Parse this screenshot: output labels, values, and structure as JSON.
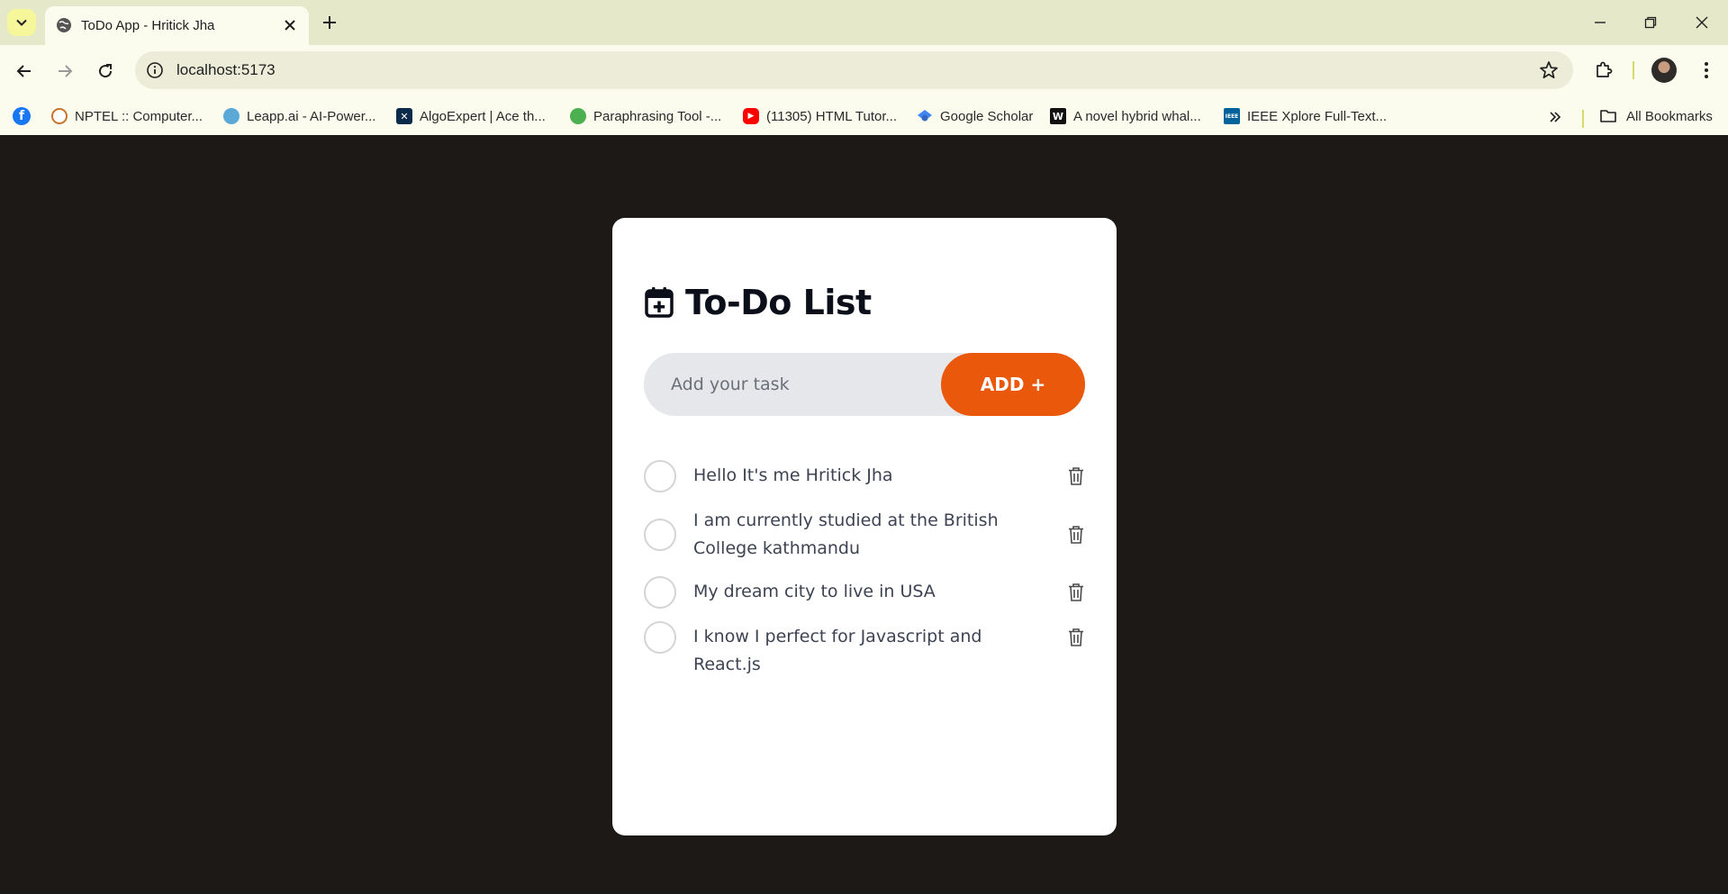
{
  "browser": {
    "tab_title": "ToDo App - Hritick Jha",
    "url": "localhost:5173",
    "bookmarks": [
      {
        "label": "NPTEL :: Computer...",
        "icon": "nptel-icon"
      },
      {
        "label": "Leapp.ai - AI-Power...",
        "icon": "leapp-icon"
      },
      {
        "label": "AlgoExpert | Ace th...",
        "icon": "algoexpert-icon"
      },
      {
        "label": "Paraphrasing Tool -...",
        "icon": "quillbot-icon"
      },
      {
        "label": "(11305) HTML Tutor...",
        "icon": "youtube-icon"
      },
      {
        "label": "Google Scholar",
        "icon": "google-scholar-icon"
      },
      {
        "label": "A novel hybrid whal...",
        "icon": "wiley-icon"
      },
      {
        "label": "IEEE Xplore Full-Text...",
        "icon": "ieee-icon"
      }
    ],
    "all_bookmarks_label": "All Bookmarks"
  },
  "app": {
    "title": "To-Do List",
    "input_placeholder": "Add your task",
    "add_button_label": "ADD +",
    "todos": [
      {
        "text": "Hello It's me Hritick Jha"
      },
      {
        "text": "I am currently studied at the British College kathmandu"
      },
      {
        "text": "My dream city to live in USA"
      },
      {
        "text": "I know I perfect for Javascript and React.js"
      }
    ]
  },
  "colors": {
    "page_background": "#1d1917",
    "card_background": "#ffffff",
    "accent": "#ea580c",
    "input_background": "#e5e7eb"
  }
}
